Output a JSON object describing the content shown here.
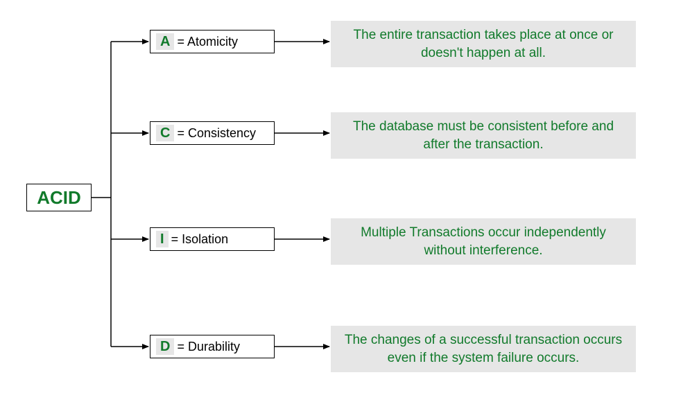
{
  "root": {
    "label": "ACID"
  },
  "items": [
    {
      "letter": "A",
      "word": "Atomicity",
      "desc": "The entire transaction takes place at once or doesn't happen at all."
    },
    {
      "letter": "C",
      "word": "Consistency",
      "desc": "The database must be consistent before and after the transaction."
    },
    {
      "letter": "I",
      "word": "Isolation",
      "desc": "Multiple Transactions occur independently without interference."
    },
    {
      "letter": "D",
      "word": "Durability",
      "desc": "The changes of a successful transaction occurs even if the system failure occurs."
    }
  ],
  "colors": {
    "text_green": "#117a2b",
    "desc_bg": "#e6e6e6"
  },
  "chart_data": {
    "type": "tree",
    "root": "ACID",
    "children": [
      {
        "key": "A",
        "label": "Atomicity",
        "description": "The entire transaction takes place at once or doesn't happen at all."
      },
      {
        "key": "C",
        "label": "Consistency",
        "description": "The database must be consistent before and after the transaction."
      },
      {
        "key": "I",
        "label": "Isolation",
        "description": "Multiple Transactions occur independently without interference."
      },
      {
        "key": "D",
        "label": "Durability",
        "description": "The changes of a successful transaction occurs even if the system failure occurs."
      }
    ]
  }
}
